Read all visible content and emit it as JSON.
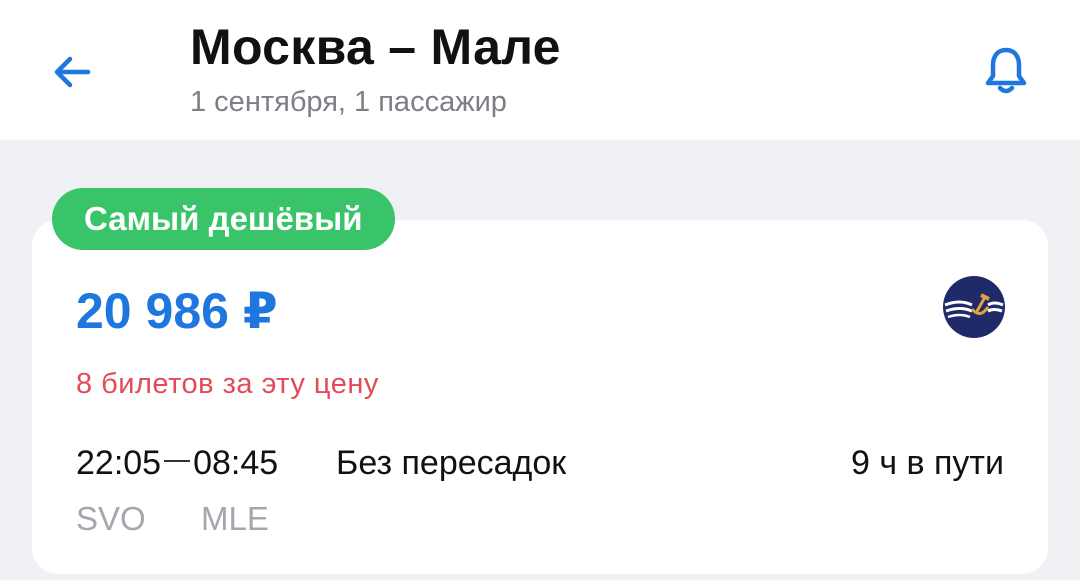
{
  "header": {
    "title": "Москва – Мале",
    "subtitle": "1 сентября, 1 пассажир",
    "back_icon": "arrow-left-icon",
    "notify_icon": "bell-icon"
  },
  "result": {
    "badge": "Самый дешёвый",
    "price": "20 986 ₽",
    "tickets_left": "8 билетов за эту цену",
    "departure_time": "22:05",
    "arrival_time": "08:45",
    "stops": "Без пересадок",
    "duration": "9 ч в пути",
    "from_code": "SVO",
    "to_code": "MLE",
    "airline_logo": "airline-logo-icon"
  },
  "colors": {
    "accent": "#1e77de",
    "badge": "#3ac46a",
    "warning": "#e24b57",
    "background": "#eff1f4",
    "logo": "#1f2a6b"
  }
}
